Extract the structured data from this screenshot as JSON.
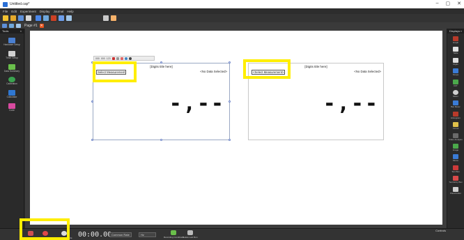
{
  "window": {
    "title": "Untitled.cap*",
    "controls": [
      "–",
      "▢",
      "✕"
    ]
  },
  "menu": [
    "File",
    "Edit",
    "Experiment",
    "Display",
    "Journal",
    "Help"
  ],
  "page_tab": {
    "label": "Page #1"
  },
  "tools_panel": {
    "header": "Tools",
    "items": [
      {
        "label": "Hardware Setup",
        "icon": "hardware-icon",
        "color": "#4a7fd0"
      },
      {
        "label": "Timer Setup",
        "icon": "timer-icon",
        "color": "#d0d0d0"
      },
      {
        "label": "Data Summary",
        "icon": "data-summary-icon",
        "color": "#6abf4b"
      },
      {
        "label": "Calibration",
        "icon": "calibration-icon",
        "color": "#3aa34f"
      },
      {
        "label": "Calculator",
        "icon": "calculator-icon",
        "color": "#2f77d1"
      },
      {
        "label": "Code",
        "icon": "code-icon",
        "color": "#d84aa0"
      }
    ]
  },
  "displays_panel": {
    "header": "Displays",
    "items": [
      {
        "label": "Graph",
        "color": "#b83a2a"
      },
      {
        "label": "Table",
        "color": "#e0e0e0"
      },
      {
        "label": "Digits",
        "color": "#e0e0e0"
      },
      {
        "label": "Scope",
        "color": "#3a7bd5"
      },
      {
        "label": "FFT",
        "color": "#4ba84b"
      },
      {
        "label": "Meter",
        "color": "#cfcfcf"
      },
      {
        "label": "Bar Meter",
        "color": "#3a7bd5"
      },
      {
        "label": "Histogram",
        "color": "#b83a2a"
      },
      {
        "label": "Circuit",
        "color": "#e0c14a"
      },
      {
        "label": "Video Analysis",
        "color": "#6a6a6a"
      },
      {
        "label": "Image",
        "color": "#4ba84b"
      },
      {
        "label": "Movie",
        "color": "#3a7bd5"
      },
      {
        "label": "Text Box",
        "color": "#cc3a3a"
      },
      {
        "label": "Text Entry Box",
        "color": "#d84a4a"
      },
      {
        "label": "Placeholder",
        "color": "#d0d0d0"
      }
    ]
  },
  "digits_displays": [
    {
      "title": "[Digits title here]",
      "no_data": "<No Data Selected>",
      "select": "Select Measurement",
      "value": "-,--"
    },
    {
      "title": "[Digits title here]",
      "no_data": "<No Data Selected>",
      "select": "<Select Measurement>",
      "value": "-,--"
    }
  ],
  "mini_toolbar": {
    "labels": [
      "000",
      "000",
      "123"
    ]
  },
  "bottom": {
    "buttons": [
      {
        "label": "Select",
        "icon": "select-icon",
        "color": "#d05050"
      },
      {
        "label": "Record",
        "icon": "record-icon",
        "color": "#e04848"
      },
      {
        "label": "Continuous Mode",
        "icon": "continuous-mode-icon",
        "color": "#dddddd"
      }
    ],
    "timer": "00:00.00",
    "sample_rate": "Common Rate",
    "rate_value": "Hz",
    "recording_conditions": "Recording Conditions",
    "delete_last_run": "Delete Last Run",
    "controls": "Controls"
  },
  "highlight_color": "#ffee00"
}
